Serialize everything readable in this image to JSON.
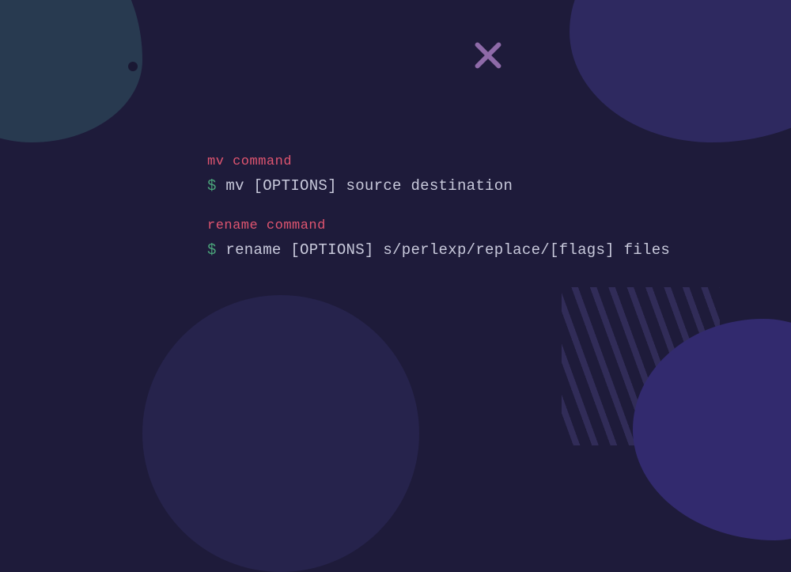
{
  "blocks": [
    {
      "label": "mv command",
      "prompt": "$",
      "command": "mv [OPTIONS] source destination"
    },
    {
      "label": "rename command",
      "prompt": "$",
      "command": "rename [OPTIONS] s/perlexp/replace/[flags] files"
    }
  ]
}
